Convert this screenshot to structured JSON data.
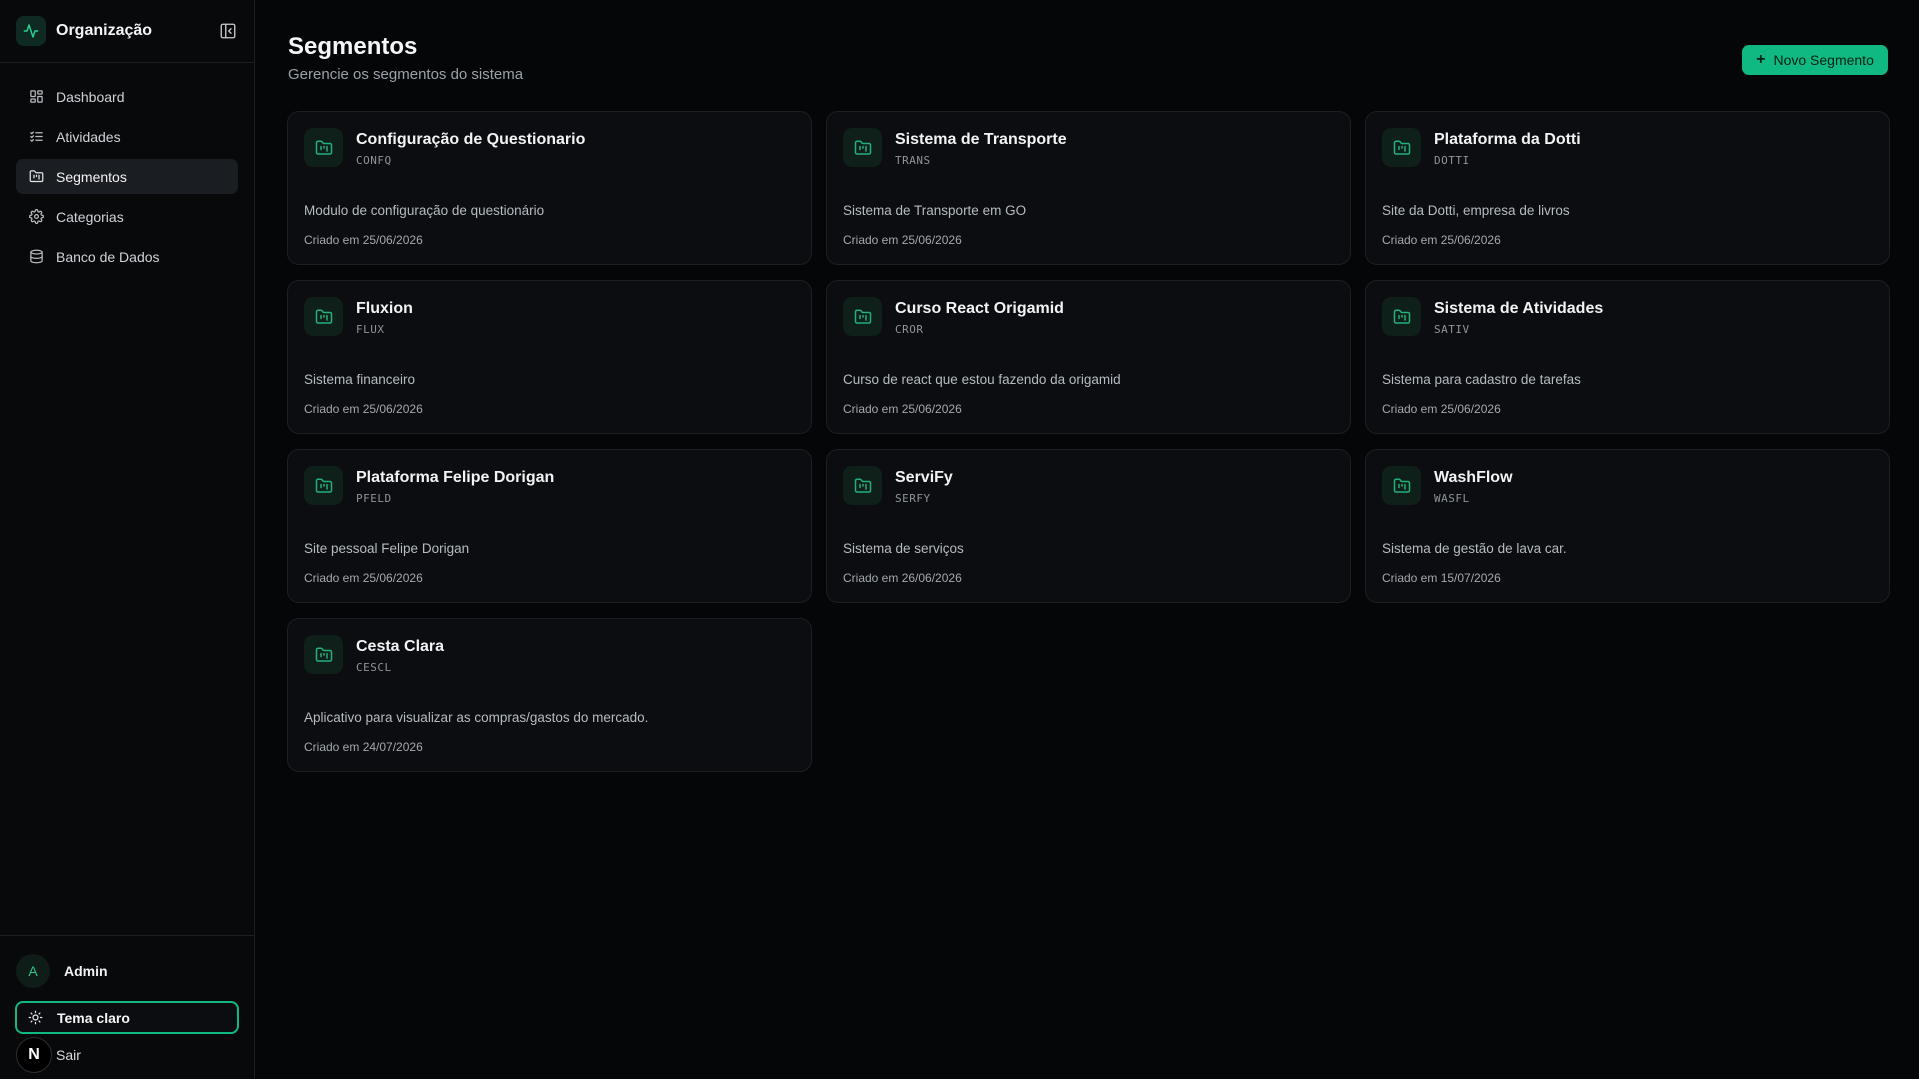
{
  "brand": {
    "title": "Organização",
    "accent": "#10b981"
  },
  "nav": {
    "items": [
      {
        "label": "Dashboard",
        "icon": "dashboard-icon",
        "active": false
      },
      {
        "label": "Atividades",
        "icon": "list-check-icon",
        "active": false
      },
      {
        "label": "Segmentos",
        "icon": "folder-kanban-icon",
        "active": true
      },
      {
        "label": "Categorias",
        "icon": "gear-icon",
        "active": false
      },
      {
        "label": "Banco de Dados",
        "icon": "database-icon",
        "active": false
      }
    ]
  },
  "user": {
    "initial": "A",
    "name": "Admin"
  },
  "theme_toggle": {
    "label": "Tema claro",
    "icon": "sun-icon"
  },
  "logout": {
    "badge": "N",
    "label": "Sair"
  },
  "header": {
    "title": "Segmentos",
    "subtitle": "Gerencie os segmentos do sistema",
    "new_button": "Novo Segmento"
  },
  "segments": [
    {
      "title": "Configuração de Questionario",
      "code": "CONFQ",
      "description": "Modulo de configuração de questionário",
      "created": "Criado em 25/06/2026"
    },
    {
      "title": "Sistema de Transporte",
      "code": "TRANS",
      "description": "Sistema de Transporte em GO",
      "created": "Criado em 25/06/2026"
    },
    {
      "title": "Plataforma da Dotti",
      "code": "DOTTI",
      "description": "Site da Dotti, empresa de livros",
      "created": "Criado em 25/06/2026"
    },
    {
      "title": "Fluxion",
      "code": "FLUX",
      "description": "Sistema financeiro",
      "created": "Criado em 25/06/2026"
    },
    {
      "title": "Curso React Origamid",
      "code": "CROR",
      "description": "Curso de react que estou fazendo da origamid",
      "created": "Criado em 25/06/2026"
    },
    {
      "title": "Sistema de Atividades",
      "code": "SATIV",
      "description": "Sistema para cadastro de tarefas",
      "created": "Criado em 25/06/2026"
    },
    {
      "title": "Plataforma Felipe Dorigan",
      "code": "PFELD",
      "description": "Site pessoal Felipe Dorigan",
      "created": "Criado em 25/06/2026"
    },
    {
      "title": "ServiFy",
      "code": "SERFY",
      "description": "Sistema de serviços",
      "created": "Criado em 26/06/2026"
    },
    {
      "title": "WashFlow",
      "code": "WASFL",
      "description": "Sistema de gestão de lava car.",
      "created": "Criado em 15/07/2026"
    },
    {
      "title": "Cesta Clara",
      "code": "CESCL",
      "description": "Aplicativo para visualizar as compras/gastos do mercado.",
      "created": "Criado em 24/07/2026"
    }
  ]
}
